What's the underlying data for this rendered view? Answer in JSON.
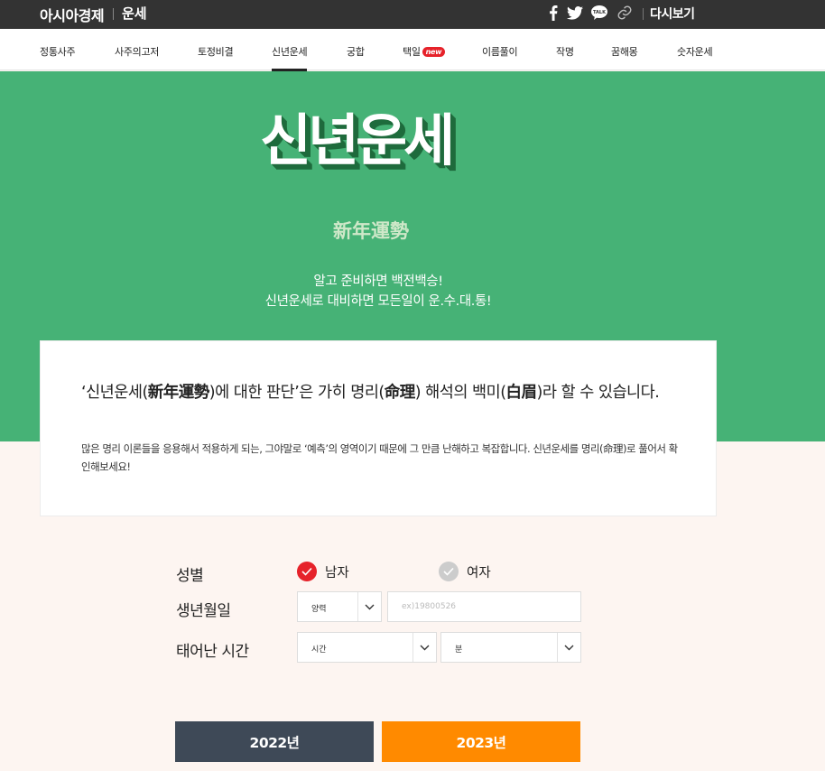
{
  "header": {
    "brand": "아시아경제",
    "section": "운세",
    "replay": "다시보기",
    "share_icons": [
      "facebook-icon",
      "twitter-icon",
      "kakaotalk-icon",
      "link-icon"
    ],
    "talk_icon_text": "TALK"
  },
  "nav": {
    "items": [
      {
        "label": "정통사주"
      },
      {
        "label": "사주의고저"
      },
      {
        "label": "토정비결"
      },
      {
        "label": "신년운세",
        "active": true
      },
      {
        "label": "궁합"
      },
      {
        "label": "택일",
        "badge": "new"
      },
      {
        "label": "이름풀이"
      },
      {
        "label": "작명"
      },
      {
        "label": "꿈해몽"
      },
      {
        "label": "숫자운세"
      }
    ]
  },
  "hero": {
    "title": "신년운세",
    "hanja": "新年運勢",
    "slogan_line1": "알고 준비하면 백전백승!",
    "slogan_line2": "신년운세로 대비하면 모든일이 운.수.대.통!"
  },
  "intro": {
    "headline_p1": "‘신년운세(",
    "headline_b1": "新年運勢",
    "headline_p2": ")에 대한 판단’은 가히 명리(",
    "headline_b2": "命理",
    "headline_p3": ") 해석의 백미(",
    "headline_b3": "白眉",
    "headline_p4": ")라 할 수 있습니다.",
    "body": "많은 명리 이론들을 응용해서 적용하게 되는, 그야말로 ‘예측’의 영역이기 때문에 그 만큼 난해하고 복잡합니다. 신년운세를 명리(命理)로 풀어서 확인해보세요!"
  },
  "form": {
    "gender_label": "성별",
    "male": "남자",
    "female": "여자",
    "selected_gender": "남자",
    "birth_label": "생년월일",
    "calendar_value": "양력",
    "birth_placeholder": "ex)19800526",
    "birth_value": "",
    "time_label": "태어난 시간",
    "hour_value": "시간",
    "minute_value": "분"
  },
  "buttons": {
    "year1": "2022년",
    "year2": "2023년"
  },
  "colors": {
    "topbar": "#333333",
    "hero_green": "#46b276",
    "accent_red": "#e6222a",
    "year1_bg": "#3e4957",
    "year2_bg": "#ff8a00",
    "page_bg": "#fdf5f1"
  }
}
